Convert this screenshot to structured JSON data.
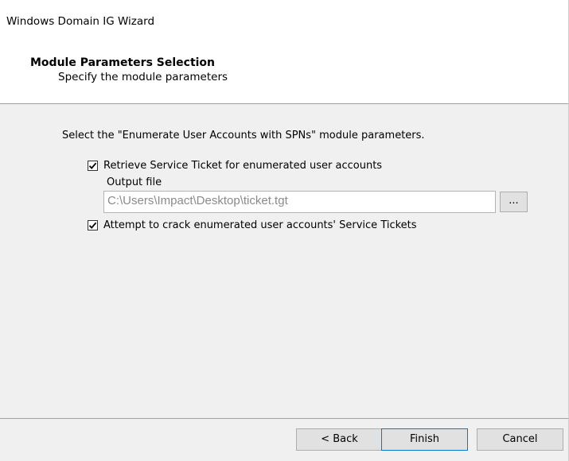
{
  "window": {
    "title": "Windows Domain IG Wizard"
  },
  "header": {
    "title": "Module Parameters Selection",
    "subtitle": "Specify the module parameters"
  },
  "main": {
    "instruction": "Select the \"Enumerate User Accounts with SPNs\" module parameters.",
    "retrieve_ticket": {
      "label": "Retrieve Service Ticket for enumerated user accounts",
      "checked": true
    },
    "output_file": {
      "label": "Output file",
      "value": "C:\\Users\\Impact\\Desktop\\ticket.tgt",
      "browse_label": "..."
    },
    "crack_tickets": {
      "label": "Attempt to crack enumerated user accounts' Service Tickets",
      "checked": true
    }
  },
  "footer": {
    "back_label": "< Back",
    "finish_label": "Finish",
    "cancel_label": "Cancel"
  },
  "icons": {
    "checkmark": "checkmark-icon"
  },
  "colors": {
    "header_bg": "#ffffff",
    "body_bg": "#f0f0f0",
    "default_button_border": "#0078d7",
    "disabled_text": "#8a8a8a"
  }
}
